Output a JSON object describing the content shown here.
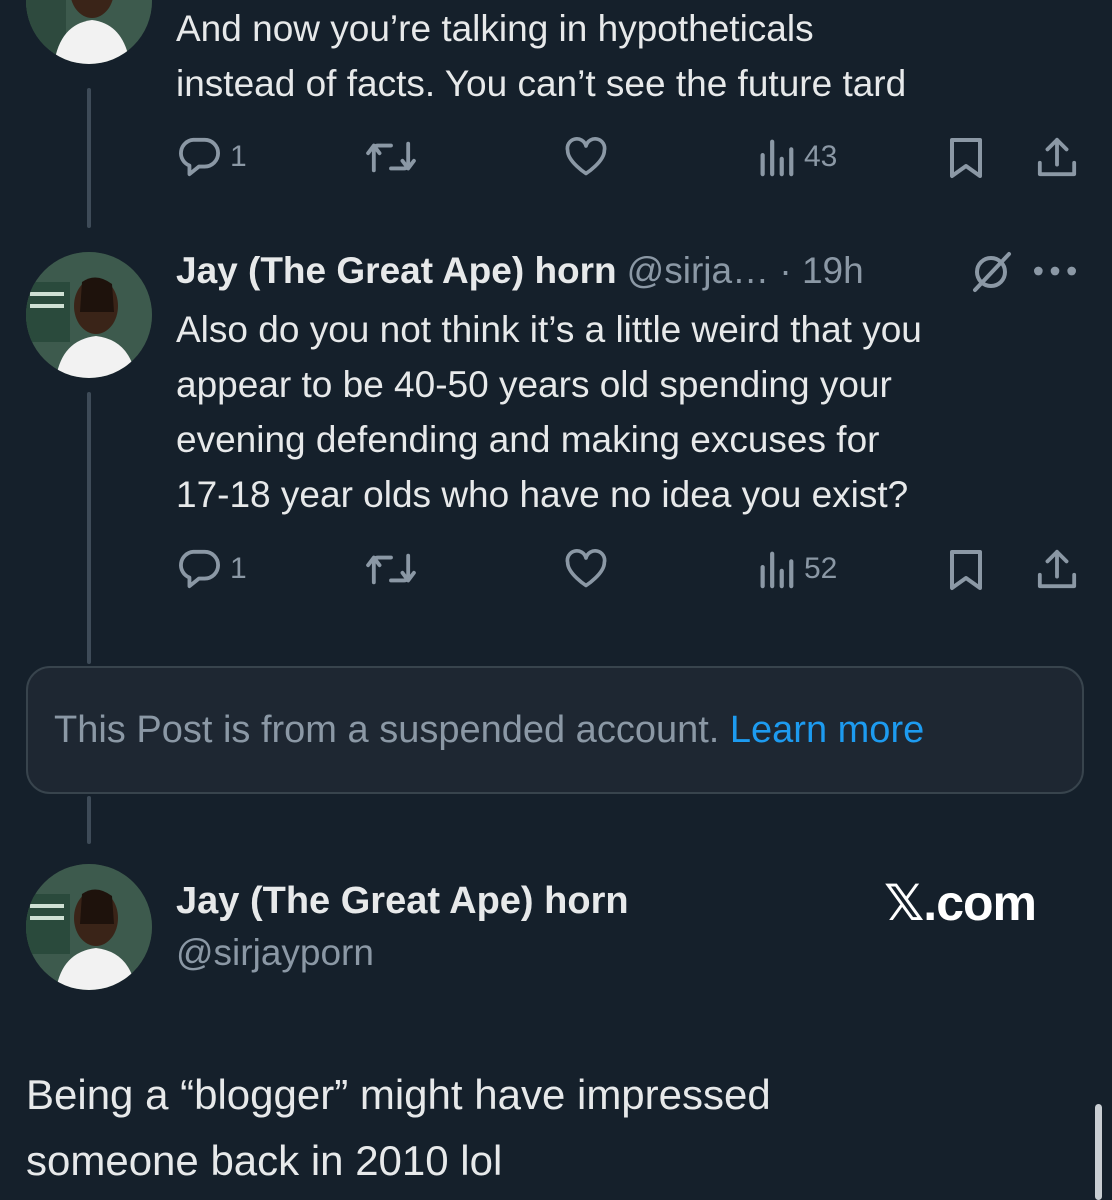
{
  "tweet1": {
    "lines": [
      "And now you’re talking in hypotheticals",
      "instead of facts. You can’t see the future tard"
    ],
    "actions": {
      "reply_count": "1",
      "views_count": "43"
    }
  },
  "tweet2": {
    "author_name": "Jay (The Great Ape) horn",
    "author_meta": "@sirja… · 19h",
    "lines": [
      "Also do you not think it’s a little weird that you",
      "appear to be 40-50 years old spending your",
      "evening defending and making excuses for",
      "17-18 year olds who have no idea you exist?"
    ],
    "actions": {
      "reply_count": "1",
      "views_count": "52"
    }
  },
  "suspended": {
    "text": "This Post is from a suspended account.",
    "link": "Learn more"
  },
  "quote": {
    "author_name": "Jay (The Great Ape) horn",
    "handle": "@sirjayporn",
    "brand_x": "𝕏",
    "brand_suffix": ".com",
    "lines": [
      "Being a “blogger” might have impressed",
      "someone back in 2010 lol"
    ]
  },
  "colors": {
    "background": "#15202b",
    "text": "#e7e9ea",
    "muted": "#8b98a5",
    "link": "#1d9bf0",
    "thread_line": "#3e4b58"
  },
  "icons": [
    "reply-icon",
    "retweet-icon",
    "like-icon",
    "views-icon",
    "bookmark-icon",
    "share-icon",
    "grok-icon",
    "more-icon"
  ]
}
